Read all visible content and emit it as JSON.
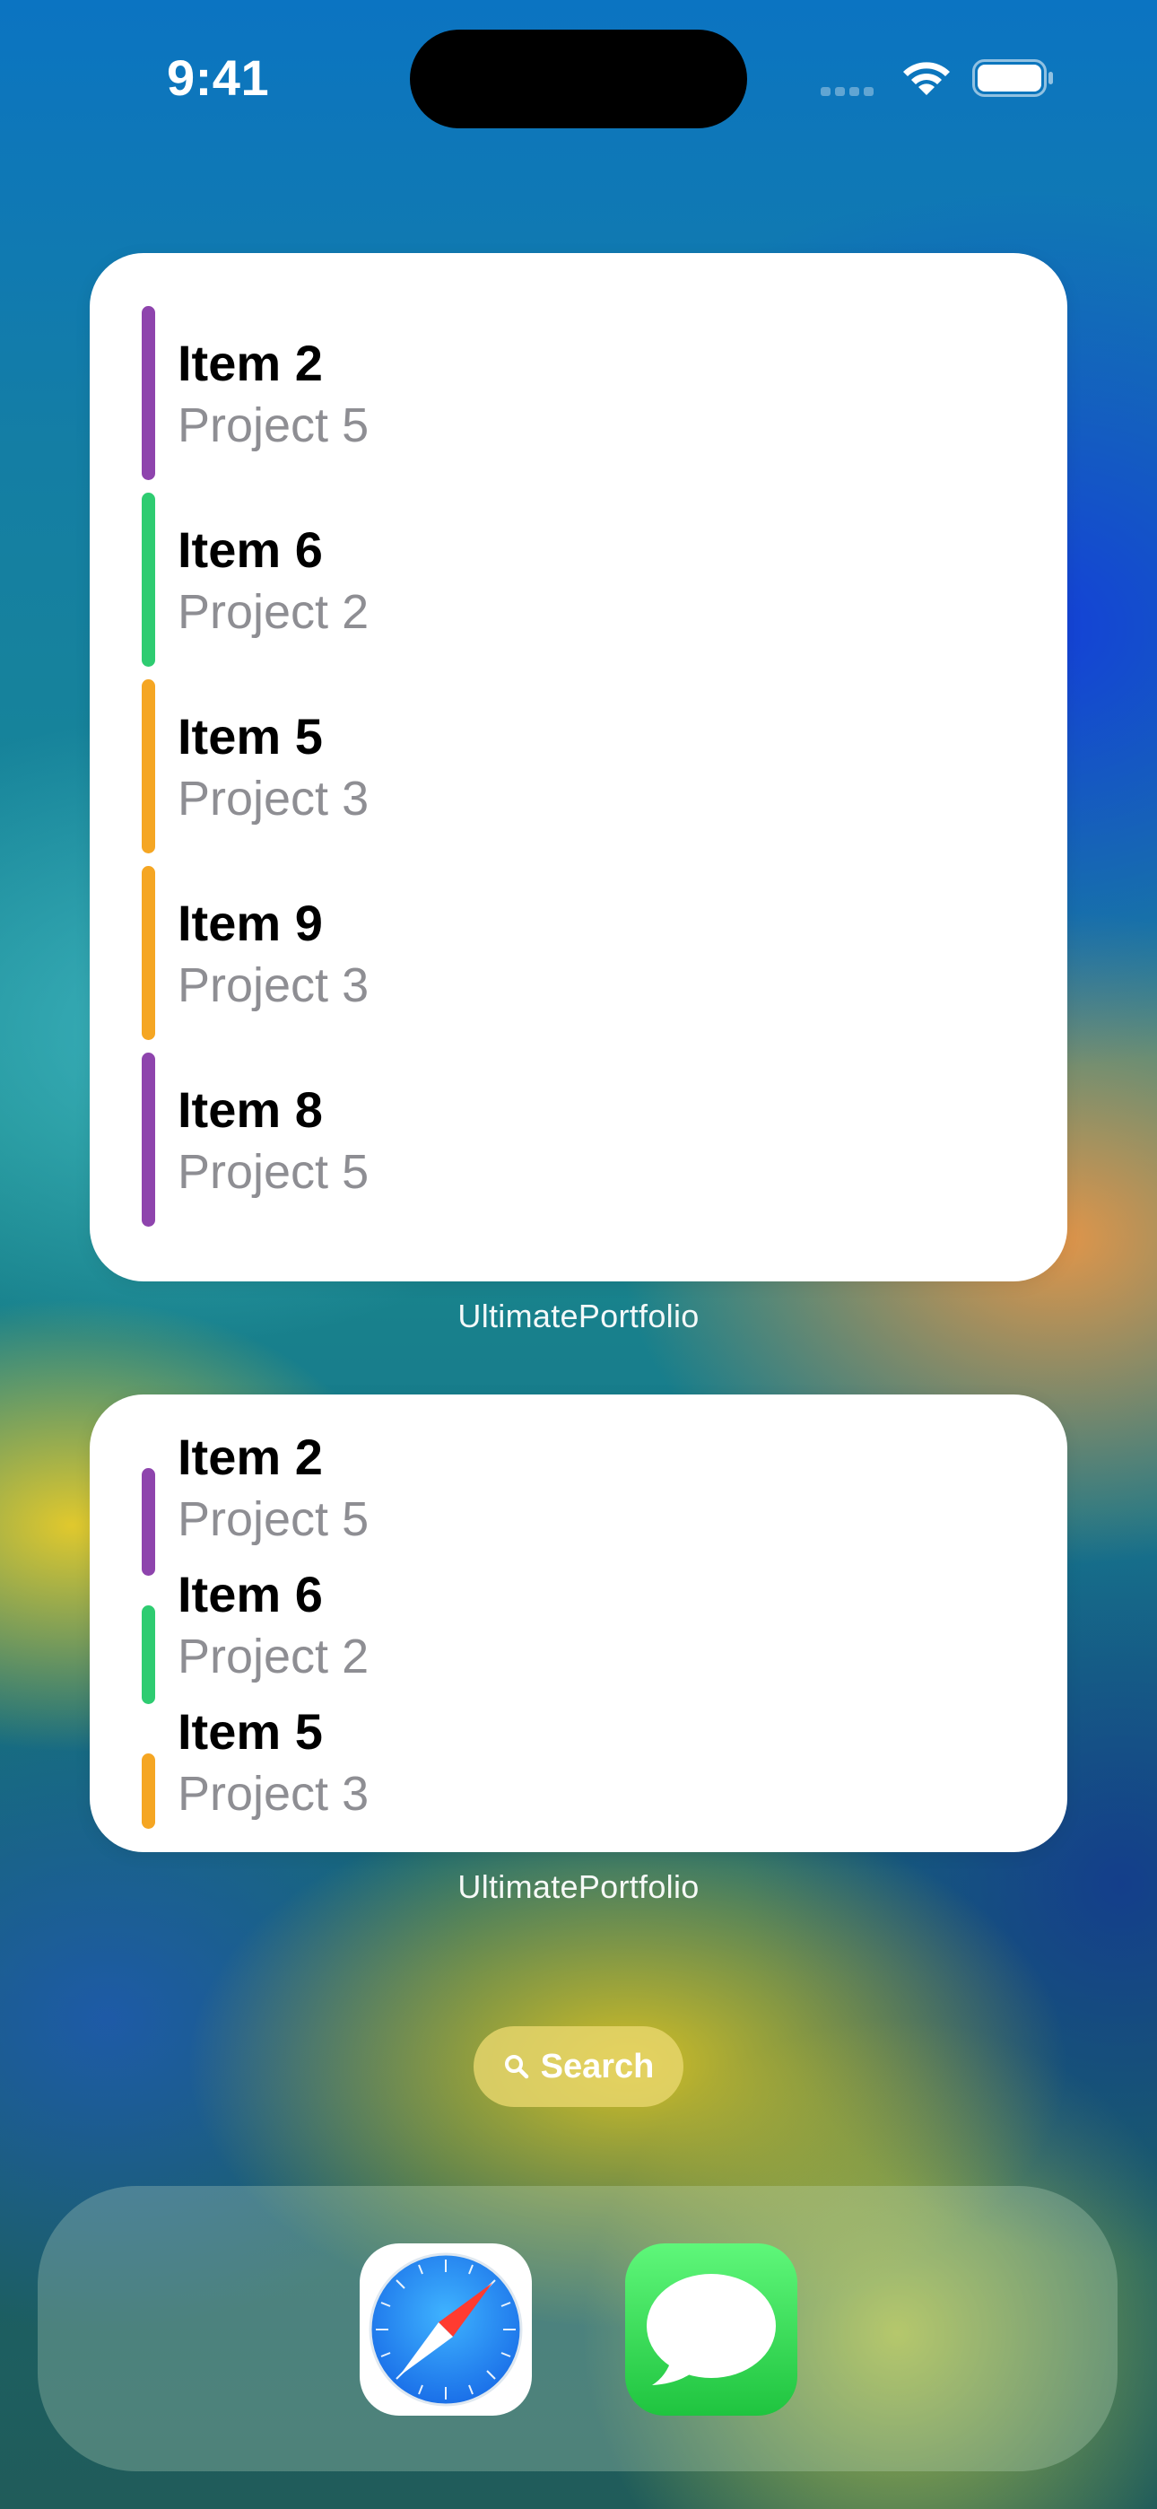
{
  "status_bar": {
    "time": "9:41"
  },
  "widgets": [
    {
      "size": "large",
      "label": "UltimatePortfolio",
      "items": [
        {
          "title": "Item 2",
          "project": "Project 5",
          "color": "#8e44ad"
        },
        {
          "title": "Item 6",
          "project": "Project 2",
          "color": "#2ecc71"
        },
        {
          "title": "Item 5",
          "project": "Project 3",
          "color": "#f5a623"
        },
        {
          "title": "Item 9",
          "project": "Project 3",
          "color": "#f5a623"
        },
        {
          "title": "Item 8",
          "project": "Project 5",
          "color": "#8e44ad"
        }
      ]
    },
    {
      "size": "medium",
      "label": "UltimatePortfolio",
      "items": [
        {
          "title": "Item 2",
          "project": "Project 5",
          "color": "#8e44ad"
        },
        {
          "title": "Item 6",
          "project": "Project 2",
          "color": "#2ecc71"
        },
        {
          "title": "Item 5",
          "project": "Project 3",
          "color": "#f5a623"
        }
      ]
    }
  ],
  "search": {
    "label": "Search",
    "icon": "magnifying-glass-icon"
  },
  "dock": {
    "apps": [
      {
        "name": "Safari",
        "icon": "safari-compass-icon"
      },
      {
        "name": "Messages",
        "icon": "messages-bubble-icon"
      }
    ]
  }
}
